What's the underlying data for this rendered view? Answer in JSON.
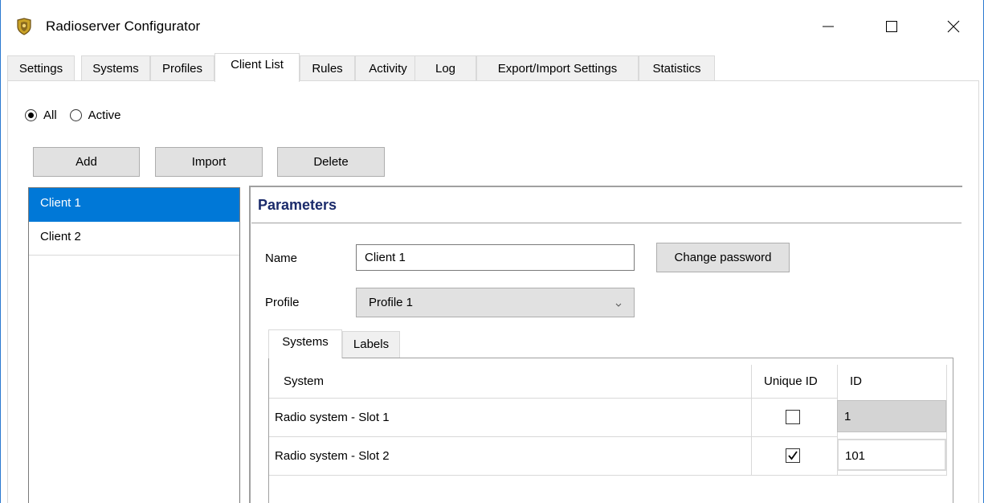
{
  "window": {
    "title": "Radioserver Configurator"
  },
  "tabs": [
    {
      "label": "Settings",
      "active": false
    },
    {
      "label": "Systems",
      "active": false
    },
    {
      "label": "Profiles",
      "active": false
    },
    {
      "label": "Client List",
      "active": true
    },
    {
      "label": "Rules",
      "active": false
    },
    {
      "label": "Activity",
      "active": false
    },
    {
      "label": "Log",
      "active": false
    },
    {
      "label": "Export/Import Settings",
      "active": false
    },
    {
      "label": "Statistics",
      "active": false
    }
  ],
  "filter": {
    "options": [
      {
        "label": "All",
        "checked": true
      },
      {
        "label": "Active",
        "checked": false
      }
    ]
  },
  "toolbar": {
    "add_label": "Add",
    "import_label": "Import",
    "delete_label": "Delete"
  },
  "clients": [
    {
      "name": "Client  1",
      "selected": true
    },
    {
      "name": "Client 2",
      "selected": false
    }
  ],
  "parameters": {
    "title": "Parameters",
    "name_label": "Name",
    "name_value": "Client  1",
    "change_password_label": "Change password",
    "profile_label": "Profile",
    "profile_value": "Profile 1",
    "subtabs": [
      {
        "label": "Systems",
        "active": true
      },
      {
        "label": "Labels",
        "active": false
      }
    ],
    "grid": {
      "columns": [
        "System",
        "Unique ID",
        "ID"
      ],
      "rows": [
        {
          "system": "Radio system - Slot 1",
          "unique_id": false,
          "id": "1"
        },
        {
          "system": "Radio system - Slot 2",
          "unique_id": true,
          "id": "101"
        }
      ]
    }
  },
  "colors": {
    "selection": "#0078d7",
    "params_title": "#1b2b6b",
    "window_border": "#2b79d0"
  }
}
